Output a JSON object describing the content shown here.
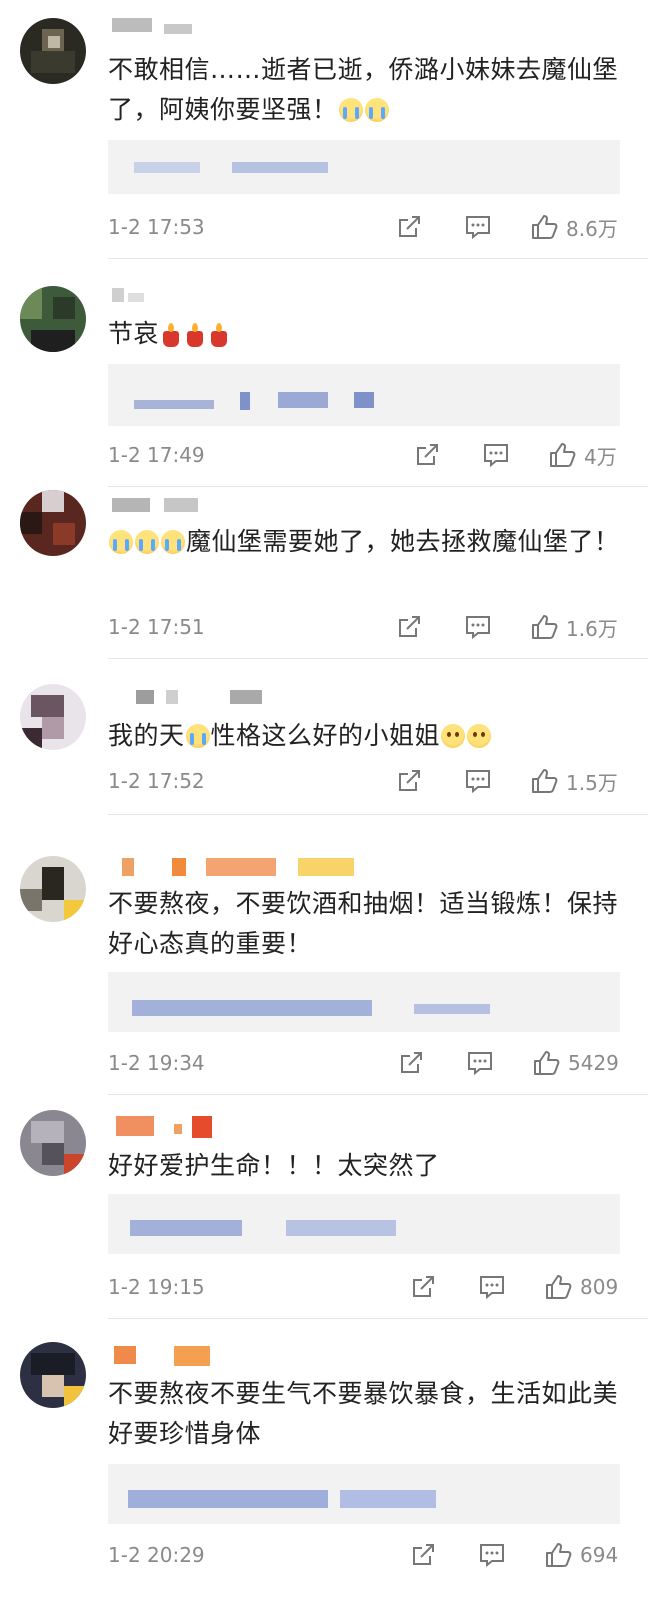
{
  "comments": [
    {
      "text_parts": [
        "不敢相信……逝者已逝，侨潞小妹妹去魔仙堡了，阿姨你要坚强！"
      ],
      "emojis": [
        "crying-face",
        "crying-face"
      ],
      "time": "1-2 17:53",
      "likes": "8.6万",
      "has_reply": true
    },
    {
      "text_parts": [
        "节哀"
      ],
      "emojis": [
        "candle",
        "candle",
        "candle"
      ],
      "time": "1-2 17:49",
      "likes": "4万",
      "has_reply": true
    },
    {
      "text_parts": [
        "魔仙堡需要她了，她去拯救魔仙堡了！"
      ],
      "emojis": [
        "crying-face",
        "crying-face",
        "crying-face"
      ],
      "time": "1-2 17:51",
      "likes": "1.6万",
      "has_reply": false
    },
    {
      "text_parts": [
        "我的天",
        "性格这么好的小姐姐"
      ],
      "emojis": [
        "crying-face",
        "pleading-face",
        "pleading-face"
      ],
      "time": "1-2 17:52",
      "likes": "1.5万",
      "has_reply": false
    },
    {
      "text_parts": [
        "不要熬夜，不要饮酒和抽烟！适当锻炼！保持好心态真的重要！"
      ],
      "time": "1-2 19:34",
      "likes": "5429",
      "has_reply": true
    },
    {
      "text_parts": [
        "好好爱护生命！！！太突然了"
      ],
      "time": "1-2 19:15",
      "likes": "809",
      "has_reply": true
    },
    {
      "text_parts": [
        "不要熬夜不要生气不要暴饮暴食，生活如此美好要珍惜身体"
      ],
      "time": "1-2 20:29",
      "likes": "694",
      "has_reply": true
    }
  ],
  "icons": {
    "share": "share-icon",
    "comment": "comment-icon",
    "like": "thumbs-up-icon"
  },
  "colors": {
    "meta_text": "#8a8a8a",
    "icon_stroke": "#777777",
    "reply_bg": "#f2f2f2",
    "blur_blue": "#8fa3d6"
  }
}
